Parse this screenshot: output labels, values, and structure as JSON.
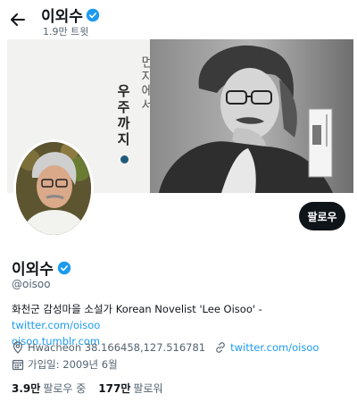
{
  "header": {
    "name": "이외수",
    "tweet_count": "1.9만 트윗"
  },
  "banner": {
    "vertical_line1": "먼지에서",
    "vertical_line2": "우주까지"
  },
  "profile": {
    "name": "이외수",
    "handle": "@oisoo",
    "bio_text": "화천군 감성마을 소설가 Korean Novelist 'Lee Oisoo' - ",
    "bio_link1": "twitter.com/oisoo",
    "bio_link2": "oisoo.tumblr.com",
    "location": "Hwacheon 38.166458,127.516781",
    "website": "twitter.com/oisoo",
    "joined": "가입일: 2009년 6월",
    "following_count": "3.9만",
    "following_label": "팔로우 중",
    "followers_count": "177만",
    "followers_label": "팔로워"
  },
  "follow_button": "팔로우",
  "colors": {
    "accent": "#1d9bf0",
    "text": "#0f1419",
    "muted": "#536471"
  }
}
